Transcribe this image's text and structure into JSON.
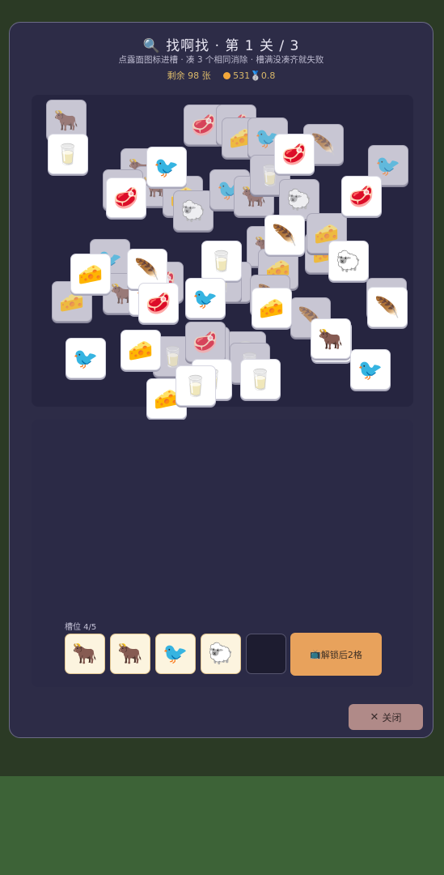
{
  "header": {
    "title_icon": "🔍",
    "title": "找啊找 · 第 1 关 / 3",
    "subtitle": "点露面图标进槽 · 凑 3 个相同消除 · 槽满没凑齐就失败",
    "remaining": "剩余 98 张",
    "coins": "531",
    "medal_icon": "🥈",
    "multiplier": "0.8"
  },
  "icons": {
    "cow": "🐂",
    "milk": "🥛",
    "meat": "🥩",
    "bird": "🐦",
    "cheese": "🧀",
    "sheep": "🐑",
    "feather": "🪶"
  },
  "board": {
    "tiles_under": [
      "cow",
      "meat",
      "meat",
      "cheese",
      "bird",
      "cow",
      "cow",
      "milk",
      "cheese",
      "sheep",
      "bird",
      "cow",
      "milk",
      "feather",
      "sheep",
      "cow",
      "cheese",
      "bird",
      "bird",
      "meat",
      "cheese",
      "cow",
      "milk",
      "feather",
      "milk",
      "bird",
      "milk",
      "feather",
      "bird",
      "cheese",
      "milk",
      "bird",
      "meat",
      "cheese"
    ],
    "tiles_top": [
      "milk",
      "meat",
      "bird",
      "milk",
      "meat",
      "bird",
      "meat",
      "feather",
      "milk",
      "sheep",
      "cheese",
      "feather",
      "meat",
      "bird",
      "cheese",
      "cow",
      "feather",
      "cheese",
      "cow",
      "bird",
      "cheese",
      "milk",
      "bird",
      "milk"
    ]
  },
  "tray": {
    "label": "槽位 4/5",
    "slots": [
      "cow",
      "cow",
      "bird",
      "sheep",
      ""
    ],
    "unlock_icon": "📺",
    "unlock_label": "解锁后2格"
  },
  "close": {
    "icon": "✕",
    "label": "关闭"
  }
}
